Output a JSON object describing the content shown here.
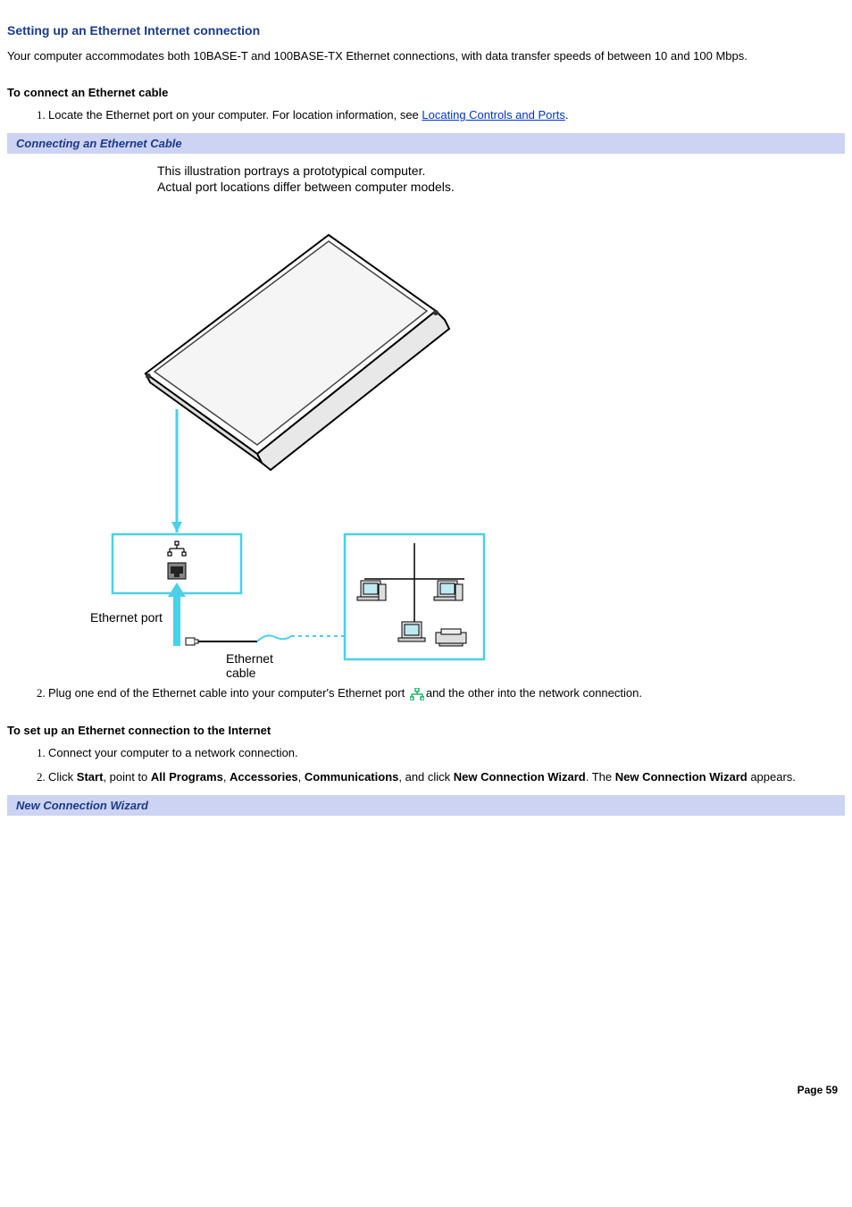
{
  "title": "Setting up an Ethernet Internet connection",
  "intro": "Your computer accommodates both 10BASE-T and 100BASE-TX Ethernet connections, with data transfer speeds of between 10 and 100 Mbps.",
  "section1": {
    "heading": "To connect an Ethernet cable",
    "step1_pre": "Locate the Ethernet port on your computer. For location information, see ",
    "step1_link": "Locating Controls and Ports",
    "step1_post": ".",
    "banner": "Connecting an Ethernet Cable",
    "caption_line1": "This illustration portrays a prototypical computer.",
    "caption_line2": "Actual port locations differ between computer models.",
    "fig_labels": {
      "ethernet_port": "Ethernet port",
      "ethernet_cable": "Ethernet",
      "ethernet_cable2": "cable"
    },
    "step2_pre": "Plug one end of the Ethernet cable into your computer's Ethernet port ",
    "step2_post": "and the other into the network connection."
  },
  "section2": {
    "heading": "To set up an Ethernet connection to the Internet",
    "step1": "Connect your computer to a network connection.",
    "step2_parts": {
      "p1": "Click ",
      "b1": "Start",
      "p2": ", point to ",
      "b2": "All Programs",
      "p3": ", ",
      "b3": "Accessories",
      "p4": ", ",
      "b4": "Communications",
      "p5": ", and click ",
      "b5": "New Connection Wizard",
      "p6": ". The ",
      "b6": "New Connection Wizard",
      "p7": " appears."
    },
    "banner": "New Connection Wizard"
  },
  "footer": "Page 59"
}
